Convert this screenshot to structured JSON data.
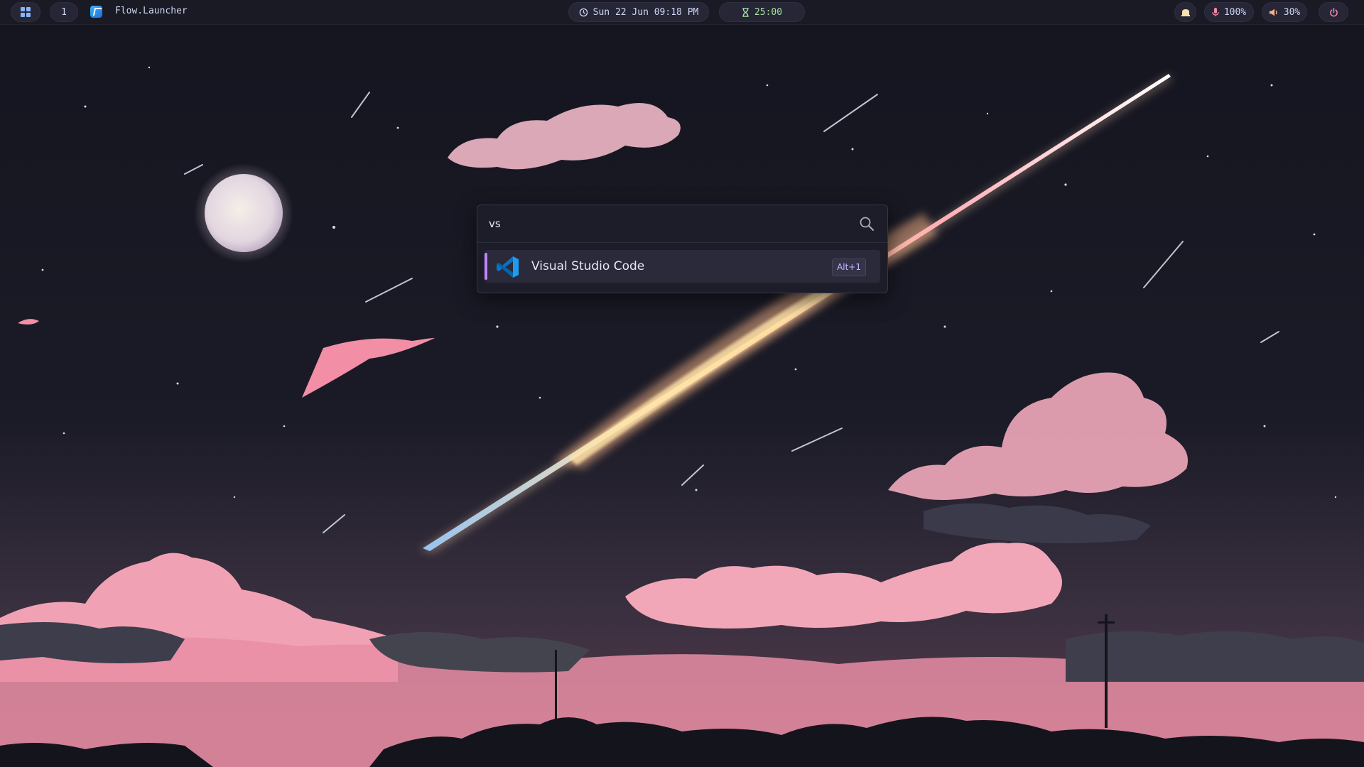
{
  "topbar": {
    "workspace_number": "1",
    "active_app_title": "Flow.Launcher",
    "clock": "Sun 22 Jun 09:18 PM",
    "timer": "25:00",
    "microphone_level": "100%",
    "volume_level": "30%"
  },
  "launcher": {
    "query": "vs",
    "results": [
      {
        "title": "Visual Studio Code",
        "hotkey": "Alt+1"
      }
    ]
  },
  "colors": {
    "accent": "#c084fc",
    "timer_green": "#a6e3a1",
    "power_pink": "#f38ba8",
    "bar_background": "#1a1a25"
  },
  "icons": {
    "start": "windows-grid-icon",
    "app": "flow-launcher-icon",
    "clock": "clock-icon",
    "timer": "hourglass-icon",
    "tray": "notification-icon",
    "mic": "microphone-icon",
    "volume": "speaker-icon",
    "power": "power-icon",
    "search": "search-icon",
    "result": "vscode-icon"
  }
}
